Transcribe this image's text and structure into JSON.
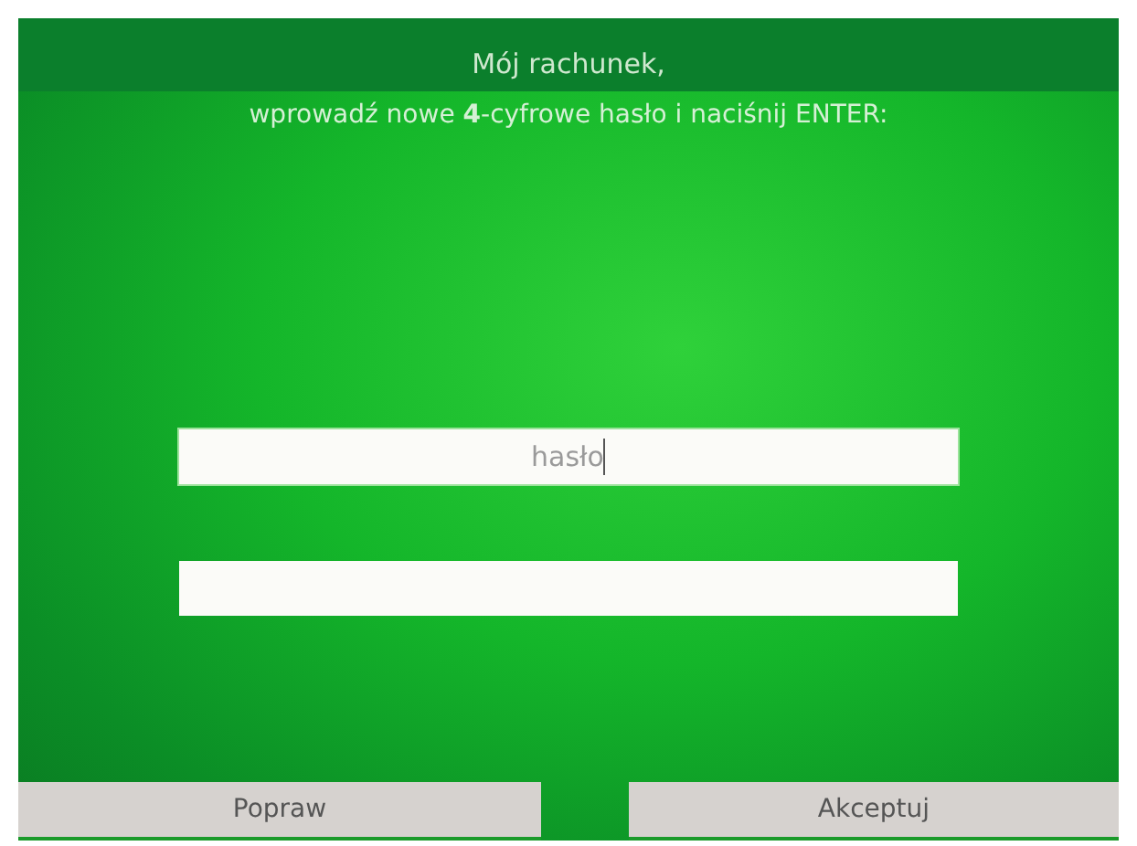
{
  "header": {
    "title": "Mój rachunek,",
    "instruction": "wprowadź nowe **4**-cyfrowe hasło i naciśnij ENTER:"
  },
  "fields": [
    {
      "placeholder": "hasło",
      "focused": true
    },
    {
      "focused": false
    }
  ],
  "buttons": [
    "Popraw",
    "Akceptuj"
  ]
}
